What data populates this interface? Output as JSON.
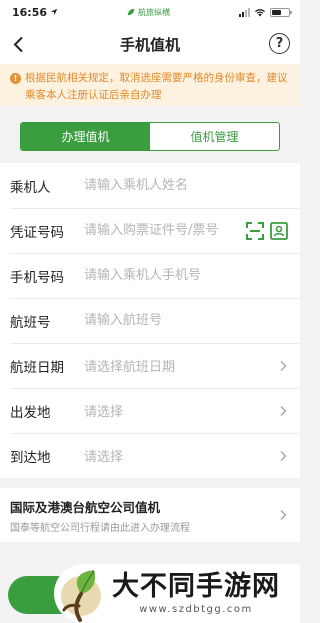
{
  "status_bar": {
    "time": "16:56",
    "carrier": "航旅纵横"
  },
  "nav": {
    "title": "手机值机",
    "help_label": "?"
  },
  "notice": {
    "icon": "!",
    "text": "根据民航相关规定，取消选座需要严格的身份审查，建议乘客本人注册认证后亲自办理"
  },
  "tabs": [
    {
      "label": "办理值机",
      "active": true
    },
    {
      "label": "值机管理",
      "active": false
    }
  ],
  "form": {
    "passenger": {
      "label": "乘机人",
      "placeholder": "请输入乘机人姓名"
    },
    "id_number": {
      "label": "凭证号码",
      "placeholder": "请输入购票证件号/票号"
    },
    "phone": {
      "label": "手机号码",
      "placeholder": "请输入乘机人手机号"
    },
    "flight_no": {
      "label": "航班号",
      "placeholder": "请输入航班号"
    },
    "flight_date": {
      "label": "航班日期",
      "placeholder": "请选择航班日期"
    },
    "departure": {
      "label": "出发地",
      "placeholder": "请选择"
    },
    "arrival": {
      "label": "到达地",
      "placeholder": "请选择"
    }
  },
  "international": {
    "title": "国际及港澳台航空公司值机",
    "subtitle": "国泰等航空公司行程请由此进入办理流程"
  },
  "watermark": {
    "title": "大不同手游网",
    "url": "www.szdbtgg.com"
  },
  "colors": {
    "accent": "#3a9d3e",
    "notice_bg": "#fdf2e0",
    "notice_text": "#e08a2a"
  }
}
